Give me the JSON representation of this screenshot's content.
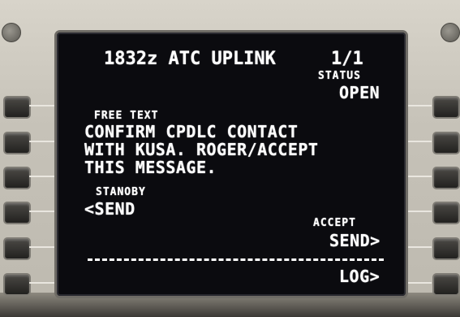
{
  "header": {
    "title": "1832z ATC UPLINK",
    "page": "1/1"
  },
  "status": {
    "label": "STATUS",
    "value": "OPEN"
  },
  "message": {
    "label": "FREE TEXT",
    "lines": [
      "CONFIRM CPDLC CONTACT",
      "WITH KUSA. ROGER/ACCEPT",
      "THIS MESSAGE."
    ]
  },
  "left": {
    "standby_label": "STANOBY",
    "send_prompt": "<SEND"
  },
  "right": {
    "accept_label": "ACCEPT",
    "send_prompt": "SEND>",
    "log_prompt": "LOG>"
  },
  "colors": {
    "screen_bg": "#0b0b0f",
    "text": "#ffffff",
    "bezel": "#c6c2b8"
  }
}
